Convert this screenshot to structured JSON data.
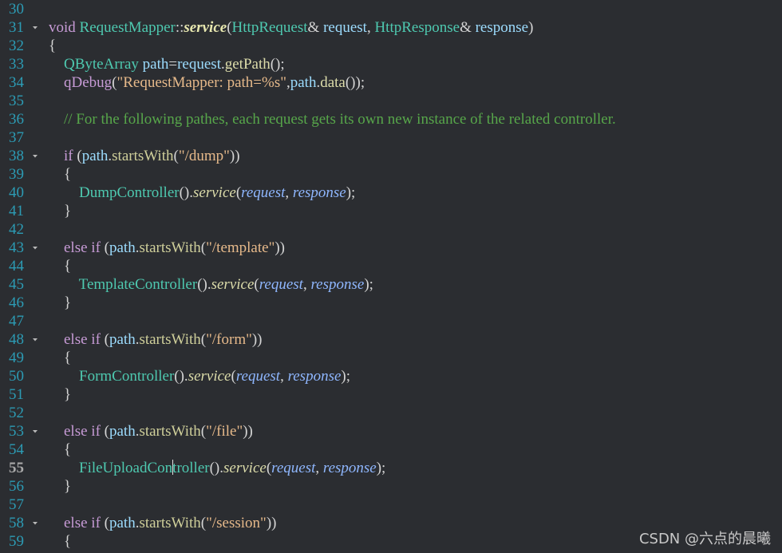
{
  "editor": {
    "current_line": "55",
    "lines": [
      {
        "n": "30",
        "tokens": []
      },
      {
        "n": "31",
        "fold": true,
        "tokens": [
          {
            "t": "void",
            "c": "kw"
          },
          {
            "t": " ",
            "c": "pn"
          },
          {
            "t": "RequestMapper",
            "c": "ty"
          },
          {
            "t": "::",
            "c": "pn"
          },
          {
            "t": "service",
            "c": "fnb"
          },
          {
            "t": "(",
            "c": "pn"
          },
          {
            "t": "HttpRequest",
            "c": "ty"
          },
          {
            "t": "& ",
            "c": "pn"
          },
          {
            "t": "request",
            "c": "id"
          },
          {
            "t": ", ",
            "c": "pn"
          },
          {
            "t": "HttpResponse",
            "c": "ty"
          },
          {
            "t": "& ",
            "c": "pn"
          },
          {
            "t": "response",
            "c": "id"
          },
          {
            "t": ")",
            "c": "pn"
          }
        ]
      },
      {
        "n": "32",
        "tokens": [
          {
            "t": "{",
            "c": "pn"
          }
        ]
      },
      {
        "n": "33",
        "tokens": [
          {
            "t": "    ",
            "c": "pn"
          },
          {
            "t": "QByteArray",
            "c": "ty"
          },
          {
            "t": " ",
            "c": "pn"
          },
          {
            "t": "path",
            "c": "id"
          },
          {
            "t": "=",
            "c": "pn"
          },
          {
            "t": "request",
            "c": "id"
          },
          {
            "t": ".",
            "c": "pn"
          },
          {
            "t": "getPath",
            "c": "fn"
          },
          {
            "t": "();",
            "c": "pn"
          }
        ]
      },
      {
        "n": "34",
        "tokens": [
          {
            "t": "    ",
            "c": "pn"
          },
          {
            "t": "qDebug",
            "c": "kw"
          },
          {
            "t": "(",
            "c": "pn"
          },
          {
            "t": "\"RequestMapper: path=%s\"",
            "c": "str"
          },
          {
            "t": ",",
            "c": "pn"
          },
          {
            "t": "path",
            "c": "id"
          },
          {
            "t": ".",
            "c": "pn"
          },
          {
            "t": "data",
            "c": "fn"
          },
          {
            "t": "());",
            "c": "pn"
          }
        ]
      },
      {
        "n": "35",
        "tokens": []
      },
      {
        "n": "36",
        "tokens": [
          {
            "t": "    ",
            "c": "pn"
          },
          {
            "t": "// For the following pathes, each request gets its own new instance of the related controller.",
            "c": "cm"
          }
        ]
      },
      {
        "n": "37",
        "tokens": []
      },
      {
        "n": "38",
        "fold": true,
        "tokens": [
          {
            "t": "    ",
            "c": "pn"
          },
          {
            "t": "if",
            "c": "kw"
          },
          {
            "t": " (",
            "c": "pn"
          },
          {
            "t": "path",
            "c": "id"
          },
          {
            "t": ".",
            "c": "pn"
          },
          {
            "t": "startsWith",
            "c": "mem"
          },
          {
            "t": "(",
            "c": "pn"
          },
          {
            "t": "\"/dump\"",
            "c": "str"
          },
          {
            "t": "))",
            "c": "pn"
          }
        ]
      },
      {
        "n": "39",
        "tokens": [
          {
            "t": "    {",
            "c": "pn"
          }
        ]
      },
      {
        "n": "40",
        "tokens": [
          {
            "t": "        ",
            "c": "pn"
          },
          {
            "t": "DumpController",
            "c": "ty"
          },
          {
            "t": "().",
            "c": "pn"
          },
          {
            "t": "service",
            "c": "fni"
          },
          {
            "t": "(",
            "c": "pn"
          },
          {
            "t": "request",
            "c": "par"
          },
          {
            "t": ", ",
            "c": "pn"
          },
          {
            "t": "response",
            "c": "par"
          },
          {
            "t": ");",
            "c": "pn"
          }
        ]
      },
      {
        "n": "41",
        "tokens": [
          {
            "t": "    }",
            "c": "pn"
          }
        ]
      },
      {
        "n": "42",
        "tokens": []
      },
      {
        "n": "43",
        "fold": true,
        "tokens": [
          {
            "t": "    ",
            "c": "pn"
          },
          {
            "t": "else if",
            "c": "kw"
          },
          {
            "t": " (",
            "c": "pn"
          },
          {
            "t": "path",
            "c": "id"
          },
          {
            "t": ".",
            "c": "pn"
          },
          {
            "t": "startsWith",
            "c": "mem"
          },
          {
            "t": "(",
            "c": "pn"
          },
          {
            "t": "\"/template\"",
            "c": "str"
          },
          {
            "t": "))",
            "c": "pn"
          }
        ]
      },
      {
        "n": "44",
        "tokens": [
          {
            "t": "    {",
            "c": "pn"
          }
        ]
      },
      {
        "n": "45",
        "tokens": [
          {
            "t": "        ",
            "c": "pn"
          },
          {
            "t": "TemplateController",
            "c": "ty"
          },
          {
            "t": "().",
            "c": "pn"
          },
          {
            "t": "service",
            "c": "fni"
          },
          {
            "t": "(",
            "c": "pn"
          },
          {
            "t": "request",
            "c": "par"
          },
          {
            "t": ", ",
            "c": "pn"
          },
          {
            "t": "response",
            "c": "par"
          },
          {
            "t": ");",
            "c": "pn"
          }
        ]
      },
      {
        "n": "46",
        "tokens": [
          {
            "t": "    }",
            "c": "pn"
          }
        ]
      },
      {
        "n": "47",
        "tokens": []
      },
      {
        "n": "48",
        "fold": true,
        "tokens": [
          {
            "t": "    ",
            "c": "pn"
          },
          {
            "t": "else if",
            "c": "kw"
          },
          {
            "t": " (",
            "c": "pn"
          },
          {
            "t": "path",
            "c": "id"
          },
          {
            "t": ".",
            "c": "pn"
          },
          {
            "t": "startsWith",
            "c": "mem"
          },
          {
            "t": "(",
            "c": "pn"
          },
          {
            "t": "\"/form\"",
            "c": "str"
          },
          {
            "t": "))",
            "c": "pn"
          }
        ]
      },
      {
        "n": "49",
        "tokens": [
          {
            "t": "    {",
            "c": "pn"
          }
        ]
      },
      {
        "n": "50",
        "tokens": [
          {
            "t": "        ",
            "c": "pn"
          },
          {
            "t": "FormController",
            "c": "ty"
          },
          {
            "t": "().",
            "c": "pn"
          },
          {
            "t": "service",
            "c": "fni"
          },
          {
            "t": "(",
            "c": "pn"
          },
          {
            "t": "request",
            "c": "par"
          },
          {
            "t": ", ",
            "c": "pn"
          },
          {
            "t": "response",
            "c": "par"
          },
          {
            "t": ");",
            "c": "pn"
          }
        ]
      },
      {
        "n": "51",
        "tokens": [
          {
            "t": "    }",
            "c": "pn"
          }
        ]
      },
      {
        "n": "52",
        "tokens": []
      },
      {
        "n": "53",
        "fold": true,
        "tokens": [
          {
            "t": "    ",
            "c": "pn"
          },
          {
            "t": "else if",
            "c": "kw"
          },
          {
            "t": " (",
            "c": "pn"
          },
          {
            "t": "path",
            "c": "id"
          },
          {
            "t": ".",
            "c": "pn"
          },
          {
            "t": "startsWith",
            "c": "mem"
          },
          {
            "t": "(",
            "c": "pn"
          },
          {
            "t": "\"/file\"",
            "c": "str"
          },
          {
            "t": "))",
            "c": "pn"
          }
        ]
      },
      {
        "n": "54",
        "tokens": [
          {
            "t": "    {",
            "c": "pn"
          }
        ]
      },
      {
        "n": "55",
        "tokens": [
          {
            "t": "        ",
            "c": "pn"
          },
          {
            "t": "FileUploadCon",
            "c": "ty"
          },
          {
            "caret": true
          },
          {
            "t": "troller",
            "c": "ty"
          },
          {
            "t": "().",
            "c": "pn"
          },
          {
            "t": "service",
            "c": "fni"
          },
          {
            "t": "(",
            "c": "pn"
          },
          {
            "t": "request",
            "c": "par"
          },
          {
            "t": ", ",
            "c": "pn"
          },
          {
            "t": "response",
            "c": "par"
          },
          {
            "t": ");",
            "c": "pn"
          }
        ]
      },
      {
        "n": "56",
        "tokens": [
          {
            "t": "    }",
            "c": "pn"
          }
        ]
      },
      {
        "n": "57",
        "tokens": []
      },
      {
        "n": "58",
        "fold": true,
        "tokens": [
          {
            "t": "    ",
            "c": "pn"
          },
          {
            "t": "else if",
            "c": "kw"
          },
          {
            "t": " (",
            "c": "pn"
          },
          {
            "t": "path",
            "c": "id"
          },
          {
            "t": ".",
            "c": "pn"
          },
          {
            "t": "startsWith",
            "c": "mem"
          },
          {
            "t": "(",
            "c": "pn"
          },
          {
            "t": "\"/session\"",
            "c": "str"
          },
          {
            "t": "))",
            "c": "pn"
          }
        ]
      },
      {
        "n": "59",
        "tokens": [
          {
            "t": "    {",
            "c": "pn"
          }
        ]
      }
    ]
  },
  "watermark": "CSDN @六点的晨曦",
  "colors": {
    "background": "#2b2d31",
    "line_number": "#2c9bb4",
    "keyword": "#c79bd6",
    "type": "#4ec9b0",
    "identifier": "#9cdcfe",
    "string": "#e6b98a",
    "comment": "#57a64a"
  },
  "icons": {
    "fold": "chevron-down-icon"
  }
}
